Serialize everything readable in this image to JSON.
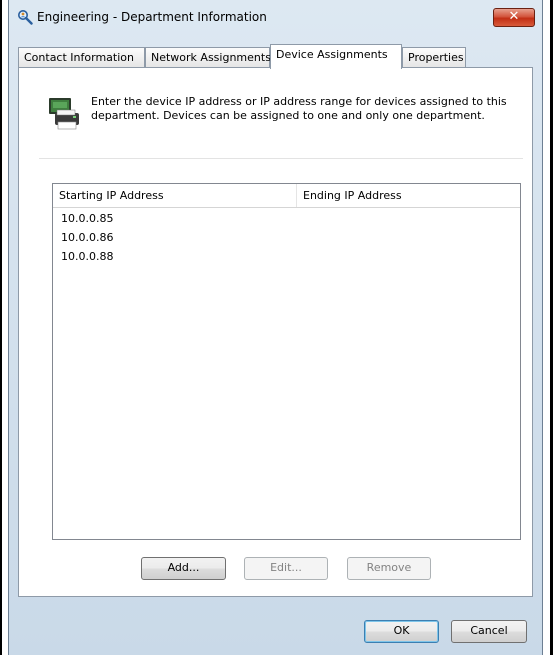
{
  "window": {
    "title": "Engineering - Department Information",
    "close_glyph": "✕",
    "app_icon": "magnifier-person-icon"
  },
  "tabs": [
    {
      "label": "Contact Information",
      "active": false
    },
    {
      "label": "Network Assignments",
      "active": false
    },
    {
      "label": "Device Assignments",
      "active": true
    },
    {
      "label": "Properties",
      "active": false
    }
  ],
  "panel": {
    "icon": "printer-device-icon",
    "description": "Enter the device IP address or IP address range for devices assigned to this department.  Devices can be assigned to one and only one department."
  },
  "list": {
    "columns": [
      "Starting IP Address",
      "Ending IP Address"
    ],
    "rows": [
      [
        "10.0.0.85",
        ""
      ],
      [
        "10.0.0.86",
        ""
      ],
      [
        "10.0.0.88",
        ""
      ]
    ]
  },
  "buttons": {
    "add": "Add...",
    "edit": "Edit...",
    "remove": "Remove",
    "ok": "OK",
    "cancel": "Cancel"
  },
  "colors": {
    "close_button": "#c22f15",
    "window_frame": "#c9d9e8",
    "default_button_border": "#3c7fb1"
  }
}
